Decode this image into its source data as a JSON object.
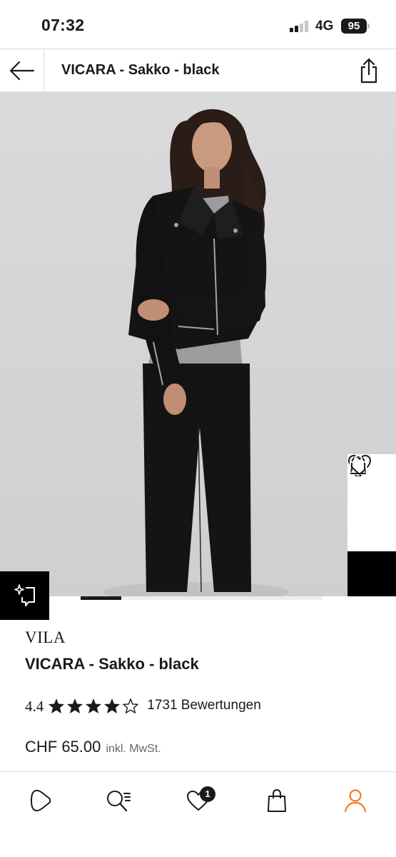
{
  "status_bar": {
    "time": "07:32",
    "network": "4G",
    "battery": "95"
  },
  "header": {
    "title": "VICARA - Sakko - black",
    "back_icon": "arrow-left-icon",
    "share_icon": "share-icon"
  },
  "gallery": {
    "current_index": 1,
    "side_actions": [
      "bell-icon",
      "heart-icon",
      "shopping-bag-icon"
    ],
    "tryon_icon": "sparkle-frame-icon"
  },
  "product": {
    "brand": "VILA",
    "name": "VICARA - Sakko - black",
    "rating": "4.4",
    "rating_stars": 4,
    "rating_max": 5,
    "reviews": "1731 Bewertungen",
    "price": "CHF 65.00",
    "tax_note": "inkl. MwSt."
  },
  "bottom_nav": {
    "items": [
      "home-play-icon",
      "search-list-icon",
      "wishlist-heart-icon",
      "bag-icon",
      "profile-icon"
    ],
    "wishlist_badge": "1",
    "active_color": "#ff6900"
  }
}
